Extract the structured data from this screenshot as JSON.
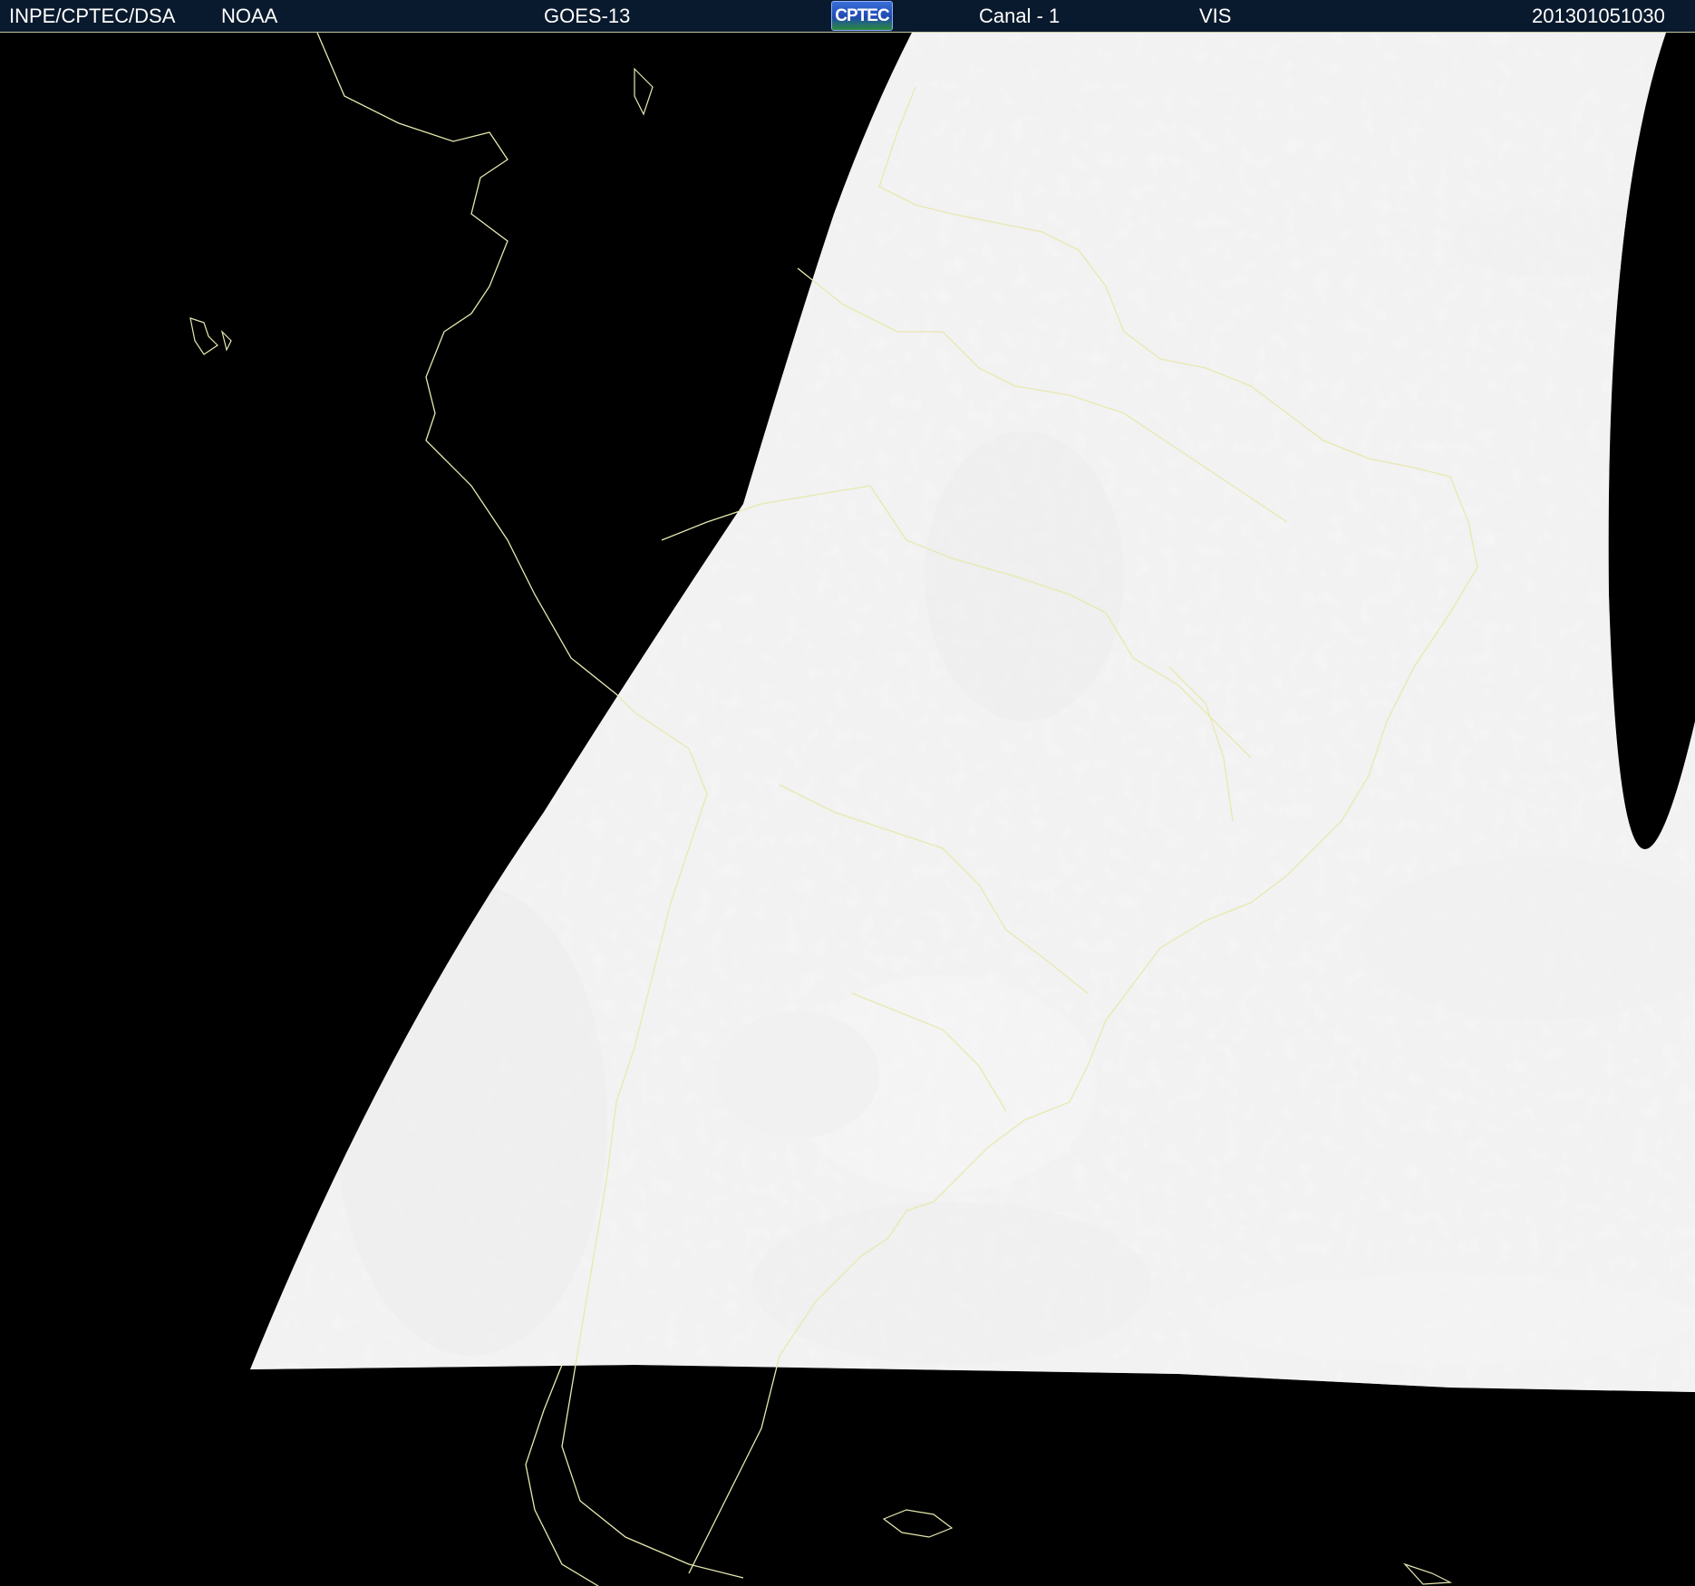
{
  "header": {
    "agency": "INPE/CPTEC/DSA",
    "source": "NOAA",
    "satellite": "GOES-13",
    "logo_text": "CPTEC",
    "channel": "Canal - 1",
    "band": "VIS",
    "timestamp": "201301051030"
  },
  "image": {
    "background_color": "#000000",
    "coastline_color": "#e8e8b0",
    "header_color": "#0a1a2e",
    "icon": "satellite-imagery"
  }
}
